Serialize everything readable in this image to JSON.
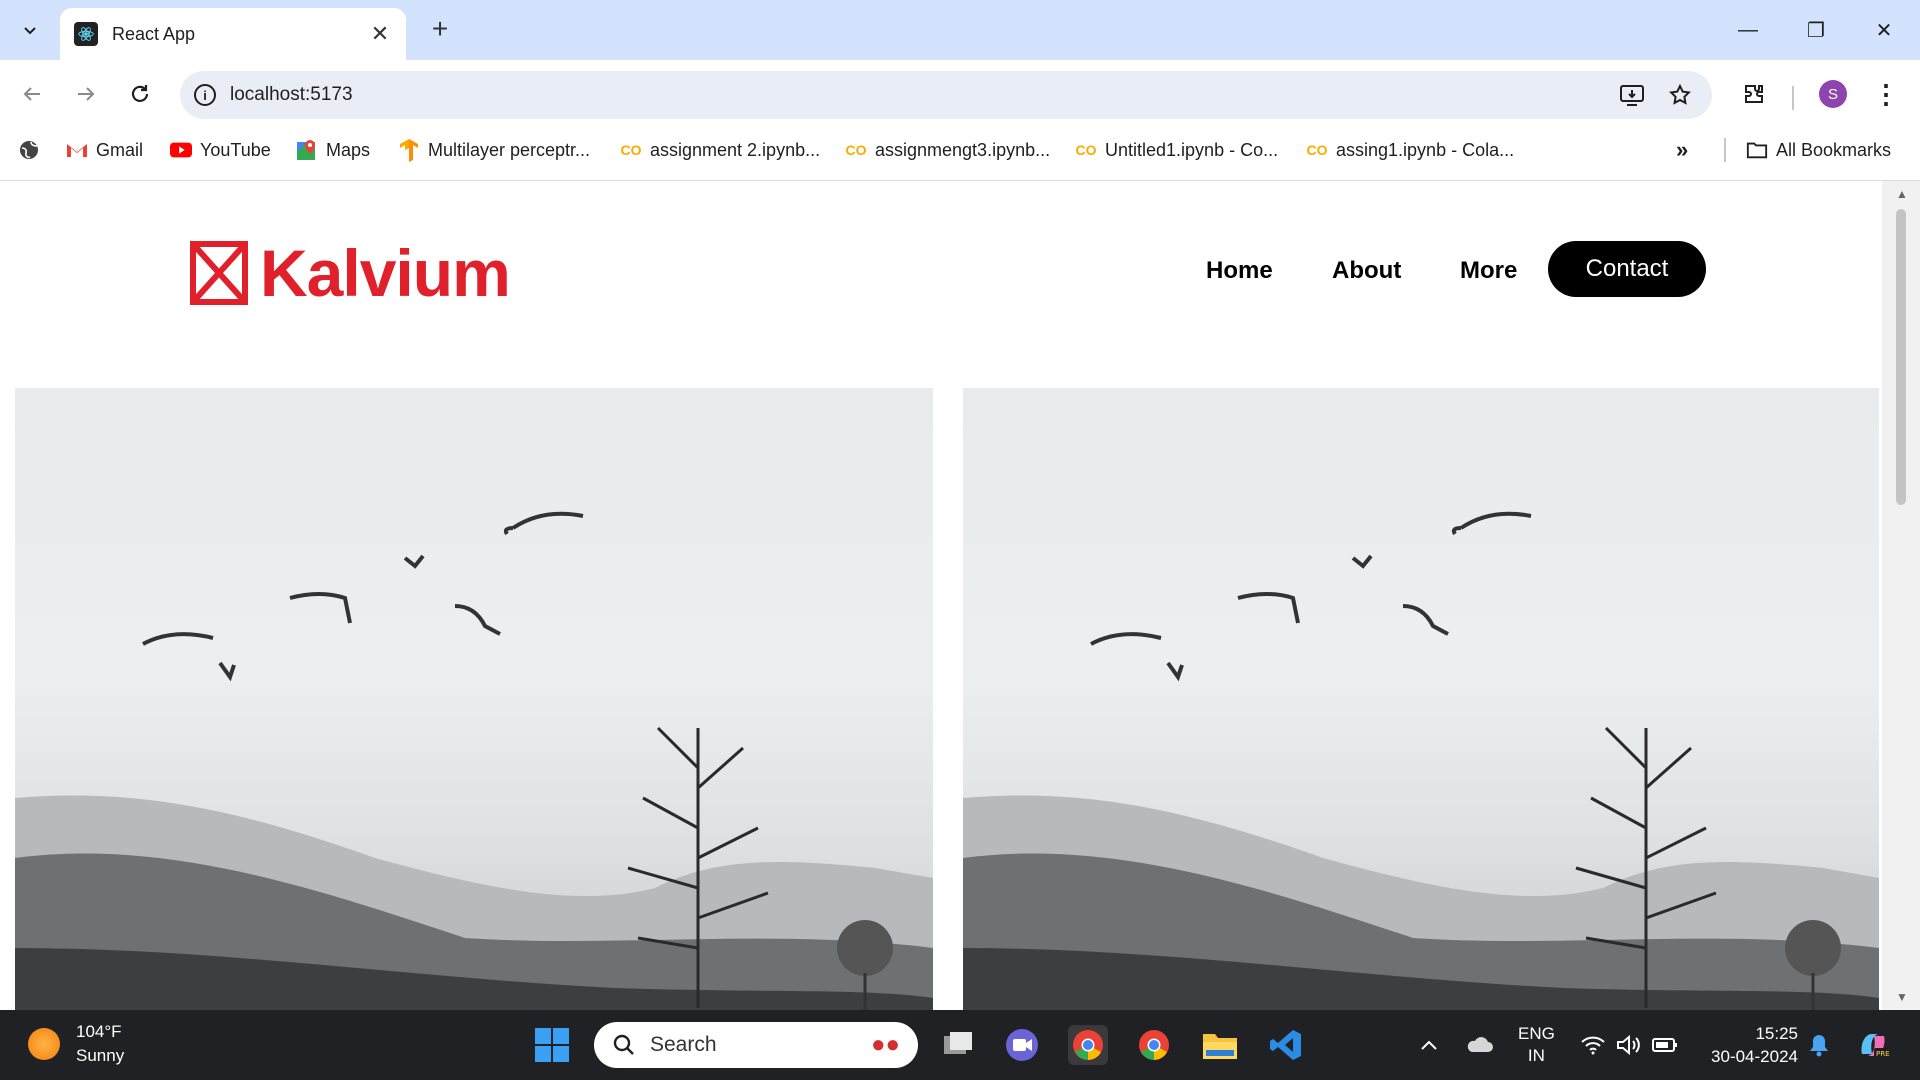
{
  "browser": {
    "tab_title": "React App",
    "url": "localhost:5173",
    "profile_initial": "S"
  },
  "bookmarks": [
    {
      "label": "Gmail",
      "icon": "gmail-icon"
    },
    {
      "label": "YouTube",
      "icon": "youtube-icon"
    },
    {
      "label": "Maps",
      "icon": "maps-icon"
    },
    {
      "label": "Multilayer perceptr...",
      "icon": "tensorflow-icon"
    },
    {
      "label": "assignment 2.ipynb...",
      "icon": "colab-icon"
    },
    {
      "label": "assignmengt3.ipynb...",
      "icon": "colab-icon"
    },
    {
      "label": "Untitled1.ipynb - Co...",
      "icon": "colab-icon"
    },
    {
      "label": "assing1.ipynb - Cola...",
      "icon": "colab-icon"
    }
  ],
  "all_bookmarks": "All Bookmarks",
  "site": {
    "brand": "Kalvium",
    "brand_color": "#e0202a",
    "nav": [
      "Home",
      "About",
      "More"
    ],
    "contact": "Contact"
  },
  "taskbar": {
    "temperature": "104°F",
    "condition": "Sunny",
    "search_placeholder": "Search",
    "lang_top": "ENG",
    "lang_bottom": "IN",
    "time": "15:25",
    "date": "30-04-2024"
  }
}
